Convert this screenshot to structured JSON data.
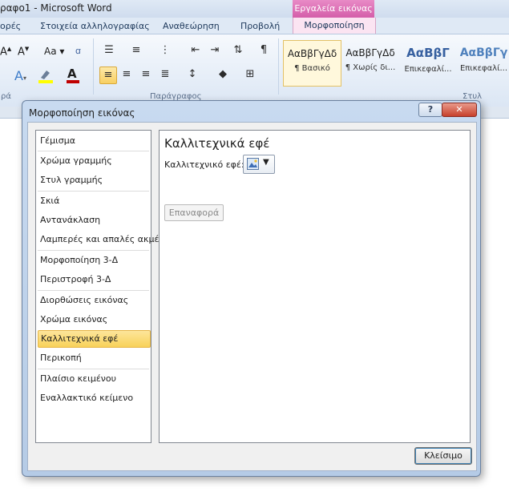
{
  "window": {
    "title": "ραφο1  -  Microsoft Word",
    "contextual_group": "Εργαλεία εικόνας"
  },
  "tabs": [
    {
      "label": "ορές"
    },
    {
      "label": "Στοιχεία αλληλογραφίας"
    },
    {
      "label": "Αναθεώρηση"
    },
    {
      "label": "Προβολή"
    },
    {
      "label": "Μορφοποίηση"
    }
  ],
  "ribbon": {
    "font_grow": "A",
    "font_shrink": "A",
    "change_case": "Aa",
    "pilcrow": "¶",
    "paragraph_group_label": "Παράγραφος",
    "font_group_tail": "ρά",
    "styles_group_tail": "Στυλ",
    "styles": [
      {
        "sample": "ΑαΒβΓγΔδ",
        "name": "¶ Βασικό"
      },
      {
        "sample": "ΑαΒβΓγΔδ",
        "name": "¶ Χωρίς δι..."
      },
      {
        "sample": "ΑαΒβΓ",
        "name": "Επικεφαλί..."
      },
      {
        "sample": "ΑαΒβΓγ",
        "name": "Επικεφαλί..."
      }
    ],
    "colors": {
      "font_color": "#c00000",
      "highlight": "#ffff00"
    }
  },
  "dialog": {
    "title": "Μορφοποίηση εικόνας",
    "help": "?",
    "close_glyph": "✕",
    "nav": [
      {
        "label": "Γέμισμα"
      },
      {
        "label": "Χρώμα γραμμής"
      },
      {
        "label": "Στυλ γραμμής"
      },
      {
        "label": "Σκιά"
      },
      {
        "label": "Αντανάκλαση"
      },
      {
        "label": "Λαμπερές και απαλές ακμές"
      },
      {
        "label": "Μορφοποίηση 3-Δ"
      },
      {
        "label": "Περιστροφή 3-Δ"
      },
      {
        "label": "Διορθώσεις εικόνας"
      },
      {
        "label": "Χρώμα εικόνας"
      },
      {
        "label": "Καλλιτεχνικά εφέ"
      },
      {
        "label": "Περικοπή"
      },
      {
        "label": "Πλαίσιο κειμένου"
      },
      {
        "label": "Εναλλακτικό κείμενο"
      }
    ],
    "active_nav": "Καλλιτεχνικά εφέ",
    "panel": {
      "title": "Καλλιτεχνικά εφέ",
      "effect_label": "Καλλιτεχνικό εφέ:",
      "reset_label": "Επαναφορά"
    },
    "close_button": "Κλείσιμο"
  }
}
